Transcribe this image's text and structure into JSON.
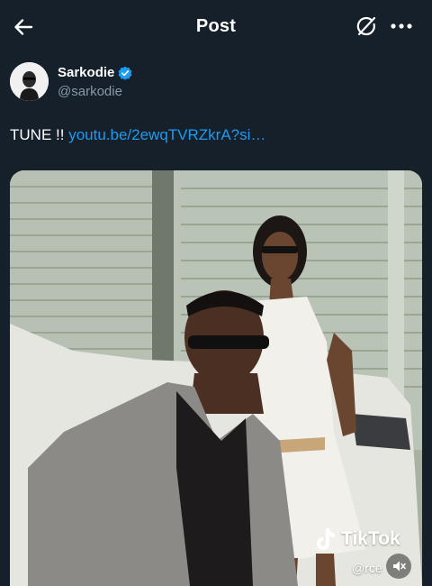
{
  "header": {
    "title": "Post",
    "back_icon": "arrow-left-icon",
    "grok_icon": "grok-icon",
    "more_icon": "more-horizontal-icon"
  },
  "author": {
    "name": "Sarkodie",
    "handle": "@sarkodie",
    "verified": true,
    "verified_color": "#1d9bf0",
    "avatar_icon": "profile-avatar"
  },
  "tweet": {
    "text": "TUNE !!",
    "link": "youtu.be/2ewqTVRZkrA?si…",
    "link_color": "#1d9bf0"
  },
  "media": {
    "watermark_brand": "TikTok",
    "watermark_user": "@rce",
    "mute_icon": "volume-muted-icon"
  },
  "colors": {
    "background": "#15202b",
    "text": "#ffffff",
    "secondary_text": "#8b98a5"
  }
}
